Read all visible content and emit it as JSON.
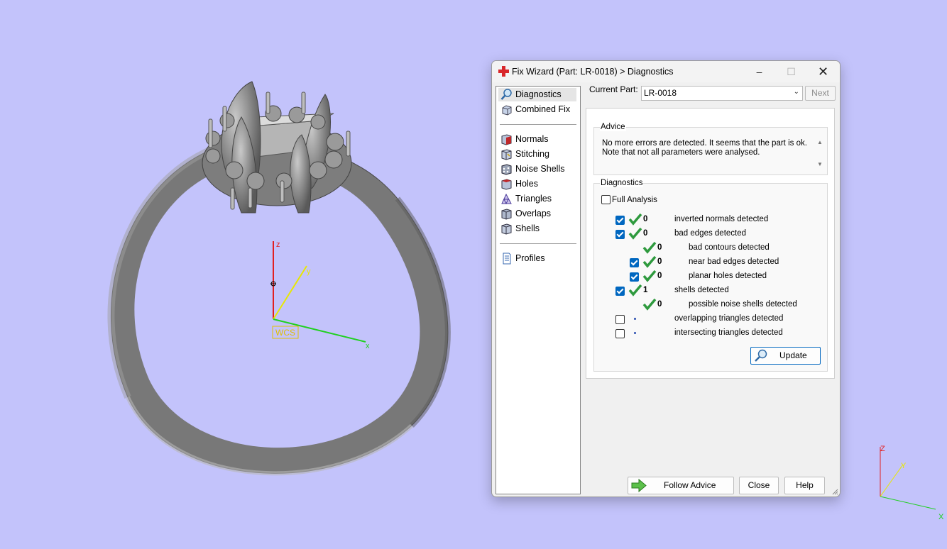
{
  "viewport": {
    "background": "#c3c3fb",
    "wcs_label": "WCS",
    "axis_labels": {
      "x": "x",
      "y": "y",
      "z": "z"
    },
    "corner_axis_labels": {
      "x": "X",
      "y": "Y",
      "z": "Z"
    }
  },
  "dialog": {
    "title": "Fix Wizard (Part: LR-0018) > Diagnostics",
    "window_controls": {
      "minimize": "–",
      "maximize": "☐",
      "close": "✕"
    },
    "nav": {
      "items": [
        {
          "label": "Diagnostics",
          "icon": "magnifier-icon",
          "selected": true
        },
        {
          "label": "Combined Fix",
          "icon": "combined-fix-icon"
        },
        {
          "label": "Normals",
          "icon": "normals-cube-icon"
        },
        {
          "label": "Stitching",
          "icon": "stitching-cube-icon"
        },
        {
          "label": "Noise Shells",
          "icon": "noise-shells-icon"
        },
        {
          "label": "Holes",
          "icon": "holes-cube-icon"
        },
        {
          "label": "Triangles",
          "icon": "triangles-icon"
        },
        {
          "label": "Overlaps",
          "icon": "overlaps-cube-icon"
        },
        {
          "label": "Shells",
          "icon": "shells-cube-icon"
        },
        {
          "label": "Profiles",
          "icon": "profiles-page-icon"
        }
      ]
    },
    "current_part_label": "Current Part:",
    "current_part_value": "LR-0018",
    "next_label": "Next",
    "advice": {
      "title": "Advice",
      "line1": "No more errors are detected. It seems that the part is ok.",
      "line2": "Note that not all parameters were analysed."
    },
    "diagnostics": {
      "title": "Diagnostics",
      "full_analysis_label": "Full Analysis",
      "full_analysis_checked": false,
      "rows": [
        {
          "label": "inverted normals detected",
          "count": "0",
          "checked": true,
          "status": "ok"
        },
        {
          "label": "bad edges detected",
          "count": "0",
          "checked": true,
          "status": "ok"
        },
        {
          "label": "bad contours detected",
          "count": "0",
          "status": "ok"
        },
        {
          "label": "near bad edges detected",
          "count": "0",
          "checked": true,
          "status": "ok"
        },
        {
          "label": "planar holes detected",
          "count": "0",
          "checked": true,
          "status": "ok"
        },
        {
          "label": "shells detected",
          "count": "1",
          "checked": true,
          "status": "ok"
        },
        {
          "label": "possible noise shells detected",
          "count": "0",
          "status": "ok"
        },
        {
          "label": "overlapping triangles detected",
          "checked": false,
          "status": "pending"
        },
        {
          "label": "intersecting triangles detected",
          "checked": false,
          "status": "pending"
        }
      ],
      "update_label": "Update"
    },
    "buttons": {
      "follow_advice": "Follow Advice",
      "close": "Close",
      "help": "Help"
    },
    "colors": {
      "check_green": "#2e9a3e",
      "accent_blue": "#0067c0",
      "brand_red": "#d8262a"
    }
  }
}
